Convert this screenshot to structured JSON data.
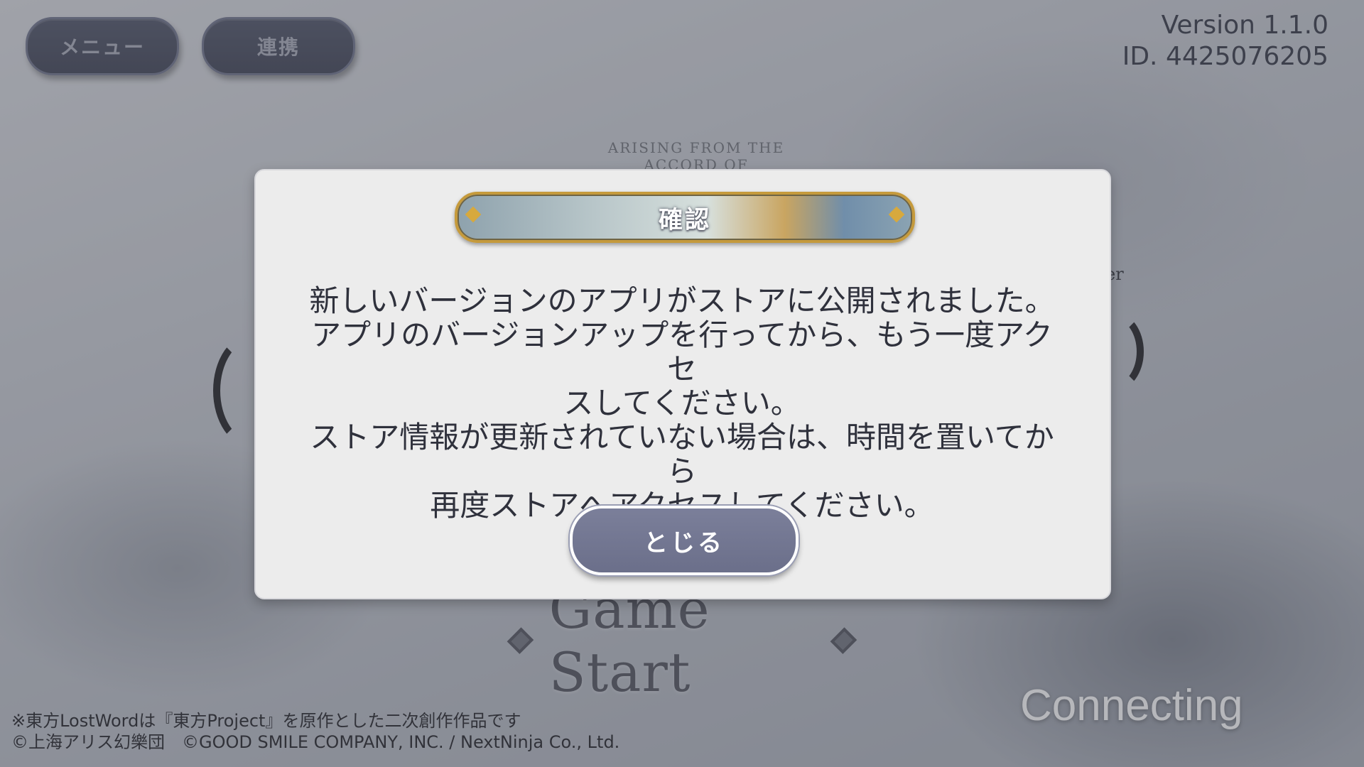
{
  "header": {
    "menu_label": "メニュー",
    "link_label": "連携",
    "version": "Version 1.1.0",
    "user_id": "ID. 4425076205"
  },
  "background": {
    "emblem_text": "ARISING FROM THE ACCORD OF",
    "side_fragment": "er",
    "game_start": "Game Start",
    "connecting": "Connecting"
  },
  "dialog": {
    "title": "確認",
    "message": "新しいバージョンのアプリがストアに公開されました。\nアプリのバージョンアップを行ってから、もう一度アクセ\nスしてください。\nストア情報が更新されていない場合は、時間を置いてから\n再度ストアへアクセスしてください。",
    "close_label": "とじる"
  },
  "footer": {
    "line1": "※東方LostWordは『東方Project』を原作とした二次創作作品です",
    "line2": "©上海アリス幻樂団　©GOOD SMILE COMPANY, INC. / NextNinja Co., Ltd."
  },
  "colors": {
    "modal_bg": "#ececec",
    "button": "#6b6f8a",
    "title_border": "#c59a3c",
    "header_button": "#3a3e50"
  }
}
